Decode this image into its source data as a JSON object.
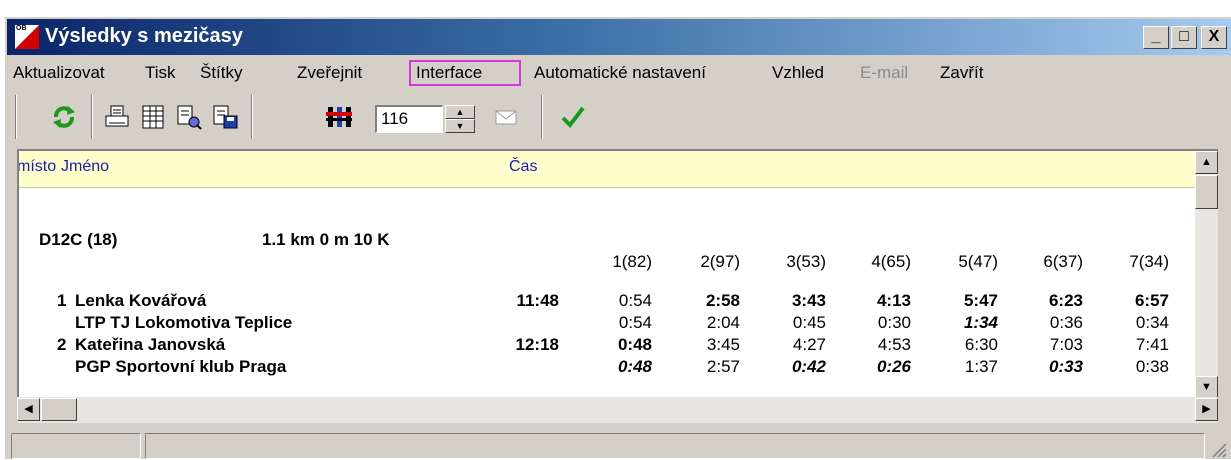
{
  "window": {
    "title": "Výsledky s mezičasy",
    "app_icon": "ob-logo-icon",
    "caption_buttons": {
      "minimize": "_",
      "maximize": "□",
      "close": "X"
    }
  },
  "menu": {
    "items": [
      {
        "label": "Aktualizovat",
        "disabled": false
      },
      {
        "label": "Tisk",
        "disabled": false
      },
      {
        "label": "Štítky",
        "disabled": false
      },
      {
        "label": "Zveřejnit",
        "disabled": false
      },
      {
        "label": "Interface",
        "disabled": false,
        "highlighted": true
      },
      {
        "label": "Automatické nastavení",
        "disabled": false
      },
      {
        "label": "Vzhled",
        "disabled": false
      },
      {
        "label": "E-mail",
        "disabled": true
      },
      {
        "label": "Zavřít",
        "disabled": false
      }
    ]
  },
  "toolbar": {
    "icons": [
      "refresh-icon",
      "print-icon",
      "table-icon",
      "print-preview-icon",
      "export-icon",
      "filter-icon",
      "mail-icon",
      "check-icon"
    ],
    "number_value": "116"
  },
  "columns": {
    "place": "místo",
    "name": "Jméno",
    "time": "Čas"
  },
  "category": {
    "name": "D12C  (18)",
    "info": "1.1 km  0 m   10 K"
  },
  "split_headers": [
    "1(82)",
    "2(97)",
    "3(53)",
    "4(65)",
    "5(47)",
    "6(37)",
    "7(34)"
  ],
  "runners": [
    {
      "place": "1",
      "name": "Lenka Kovářová",
      "club": "LTP TJ Lokomotiva Teplice",
      "time": "11:48",
      "cumulative": [
        "0:54",
        "2:58",
        "3:43",
        "4:13",
        "5:47",
        "6:23",
        "6:57"
      ],
      "legs": [
        "0:54",
        "2:04",
        "0:45",
        "0:30",
        "1:34",
        "0:36",
        "0:34"
      ]
    },
    {
      "place": "2",
      "name": "Kateřina Janovská",
      "club": "PGP Sportovní klub Praga",
      "time": "12:18",
      "cumulative": [
        "0:48",
        "3:45",
        "4:27",
        "4:53",
        "6:30",
        "7:03",
        "7:41"
      ],
      "legs": [
        "0:48",
        "2:57",
        "0:42",
        "0:26",
        "1:37",
        "0:33",
        "0:38"
      ]
    }
  ],
  "colors": {
    "title_gradient_start": "#0a246a",
    "title_gradient_end": "#a6caf0",
    "header_bg": "#ffffcc",
    "header_text": "#1c1cb4",
    "menu_highlight": "#d637d6"
  }
}
